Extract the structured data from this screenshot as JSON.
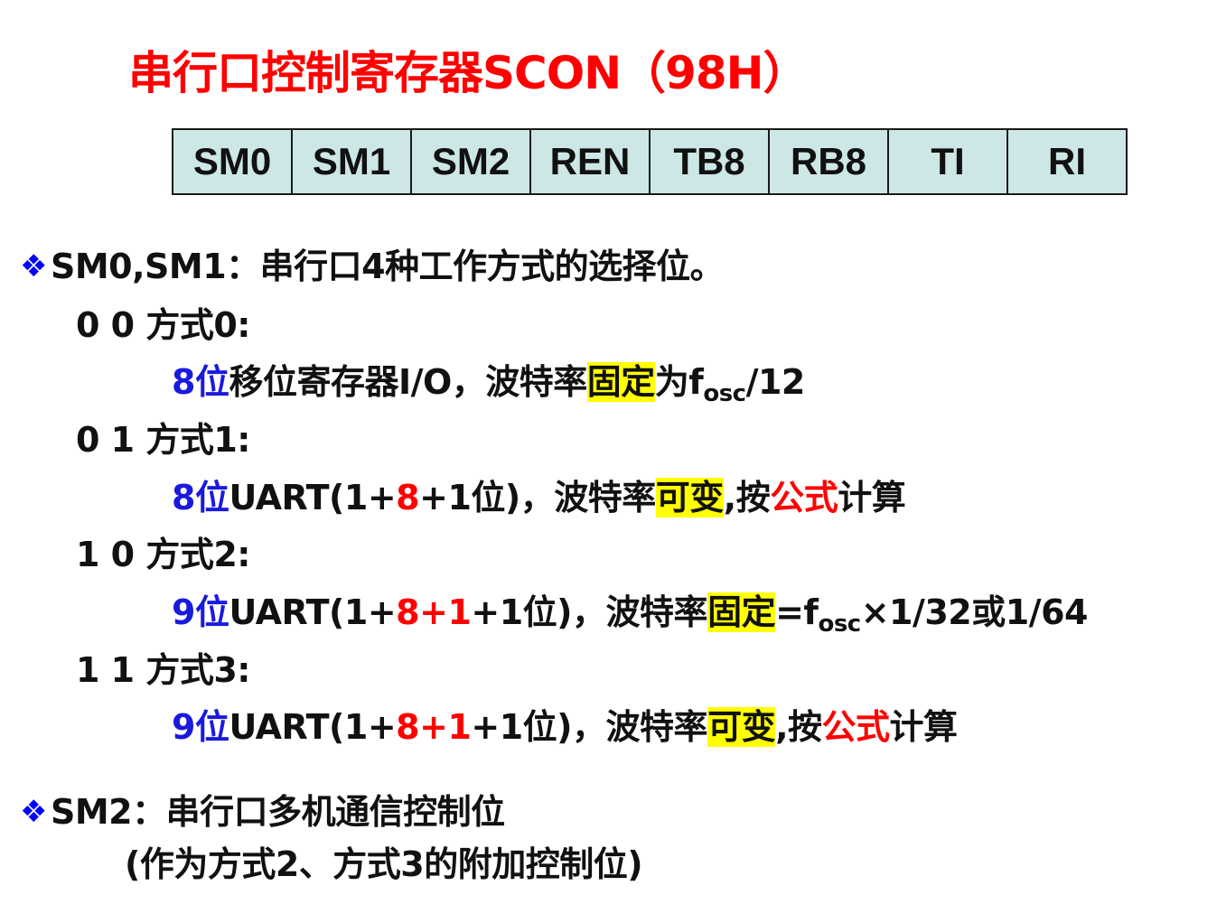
{
  "title": "串行口控制寄存器SCON（98H）",
  "register_bits": [
    "SM0",
    "SM1",
    "SM2",
    "REN",
    "TB8",
    "RB8",
    "TI",
    "RI"
  ],
  "bullet_icon": "diamond-cluster-icon",
  "colors": {
    "title": "#ff0000",
    "bullet": "#0000ff",
    "bits_text": "#1a1adc",
    "accent_red": "#ff0000",
    "highlight": "#ffff00",
    "table_fill": "#cde7e7"
  },
  "sm01": {
    "heading": "SM0,SM1：串行口4种工作方式的选择位。",
    "mode0": {
      "code": "0   0  方式0:",
      "bits": "8位",
      "text1": "移位寄存器I/O，波特率",
      "hl": "固定",
      "text2": "为f",
      "sub": "osc",
      "text3": "/12"
    },
    "mode1": {
      "code": "0   1  方式1:",
      "bits": "8位",
      "text1": "UART(1+",
      "red1": "8",
      "text2": "+1位)，波特率",
      "hl": "可变",
      "text3": ",按",
      "red2": "公式",
      "text4": "计算"
    },
    "mode2": {
      "code": "1   0  方式2:",
      "bits": "9位",
      "text1": "UART(1+",
      "red1": "8+1",
      "text2": "+1位)，波特率",
      "hl": "固定",
      "text3": "=f",
      "sub": "osc",
      "text4": "×1/32或1/64"
    },
    "mode3": {
      "code": "1   1 方式3:",
      "bits": "9位",
      "text1": "UART(1+",
      "red1": "8+1",
      "text2": "+1位)，波特率",
      "hl": "可变",
      "text3": ",按",
      "red2": "公式",
      "text4": "计算"
    }
  },
  "sm2": {
    "heading": "SM2：串行口多机通信控制位",
    "note": "(作为方式2、方式3的附加控制位)"
  }
}
